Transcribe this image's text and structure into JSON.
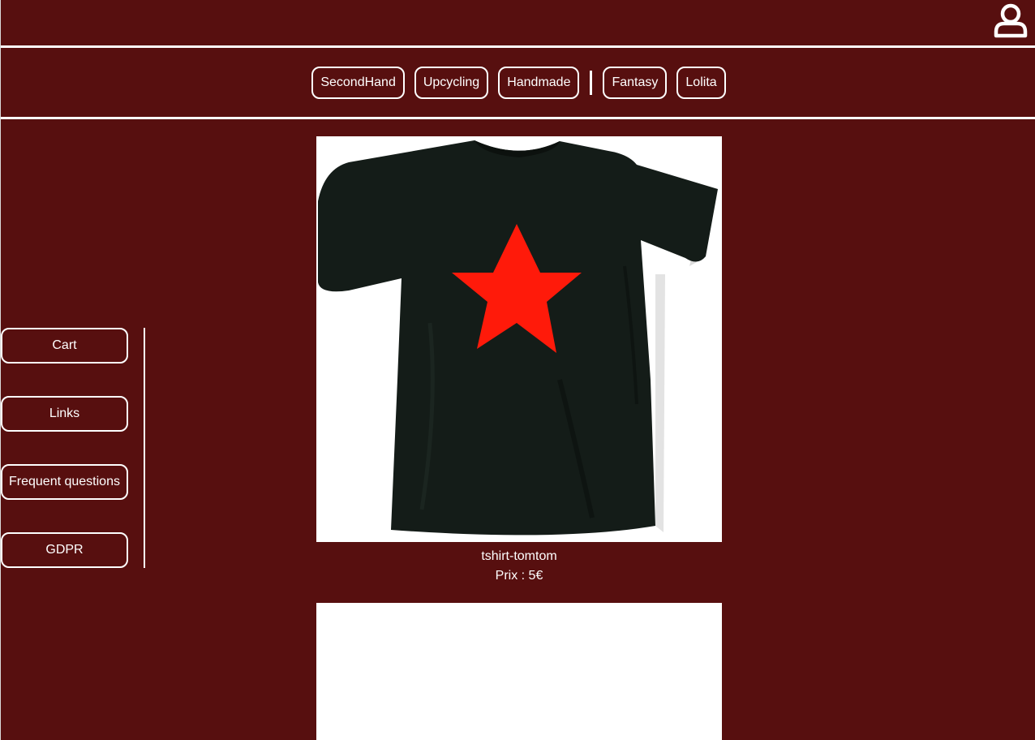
{
  "header": {
    "user_icon": "user-icon"
  },
  "categories": {
    "left": [
      "SecondHand",
      "Upcycling",
      "Handmade"
    ],
    "right": [
      "Fantasy",
      "Lolita"
    ]
  },
  "sidebar": {
    "items": [
      "Cart",
      "Links",
      "Frequent questions",
      "GDPR"
    ]
  },
  "products": [
    {
      "name": "tshirt-tomtom",
      "price": "Prix : 5€",
      "image": "black-tshirt-red-star"
    }
  ],
  "colors": {
    "background": "#570f0f",
    "foreground": "#ffffff",
    "star": "#ff1a0a",
    "shirt": "#141c18"
  }
}
